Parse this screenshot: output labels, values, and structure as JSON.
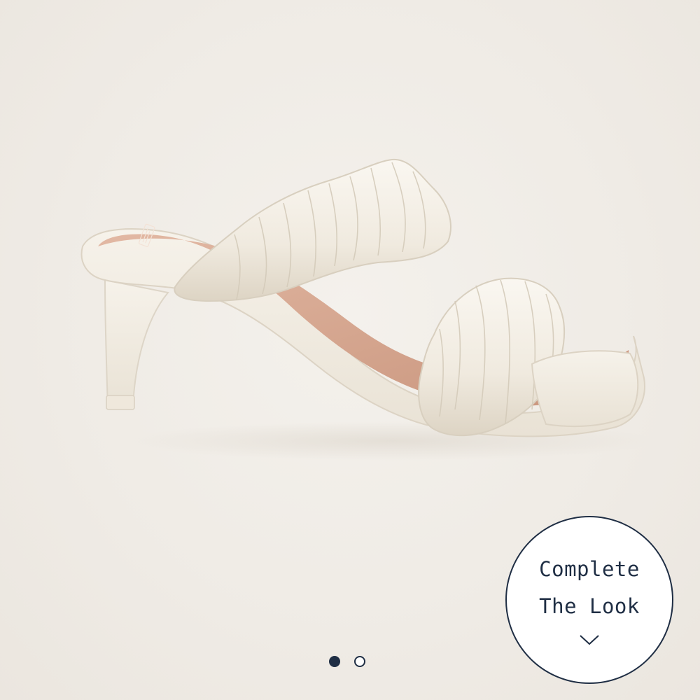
{
  "product": {
    "image_alt": "Ivory ruched double-strap heeled mule sandal",
    "colors": {
      "background": "#efebe5",
      "shoe": "#f3eee4",
      "insole": "#d8a993",
      "accent": "#1f2e44"
    }
  },
  "carousel": {
    "count": 2,
    "active_index": 0
  },
  "complete_look": {
    "line1": "Complete",
    "line2": "The Look",
    "icon": "chevron-down-icon"
  }
}
